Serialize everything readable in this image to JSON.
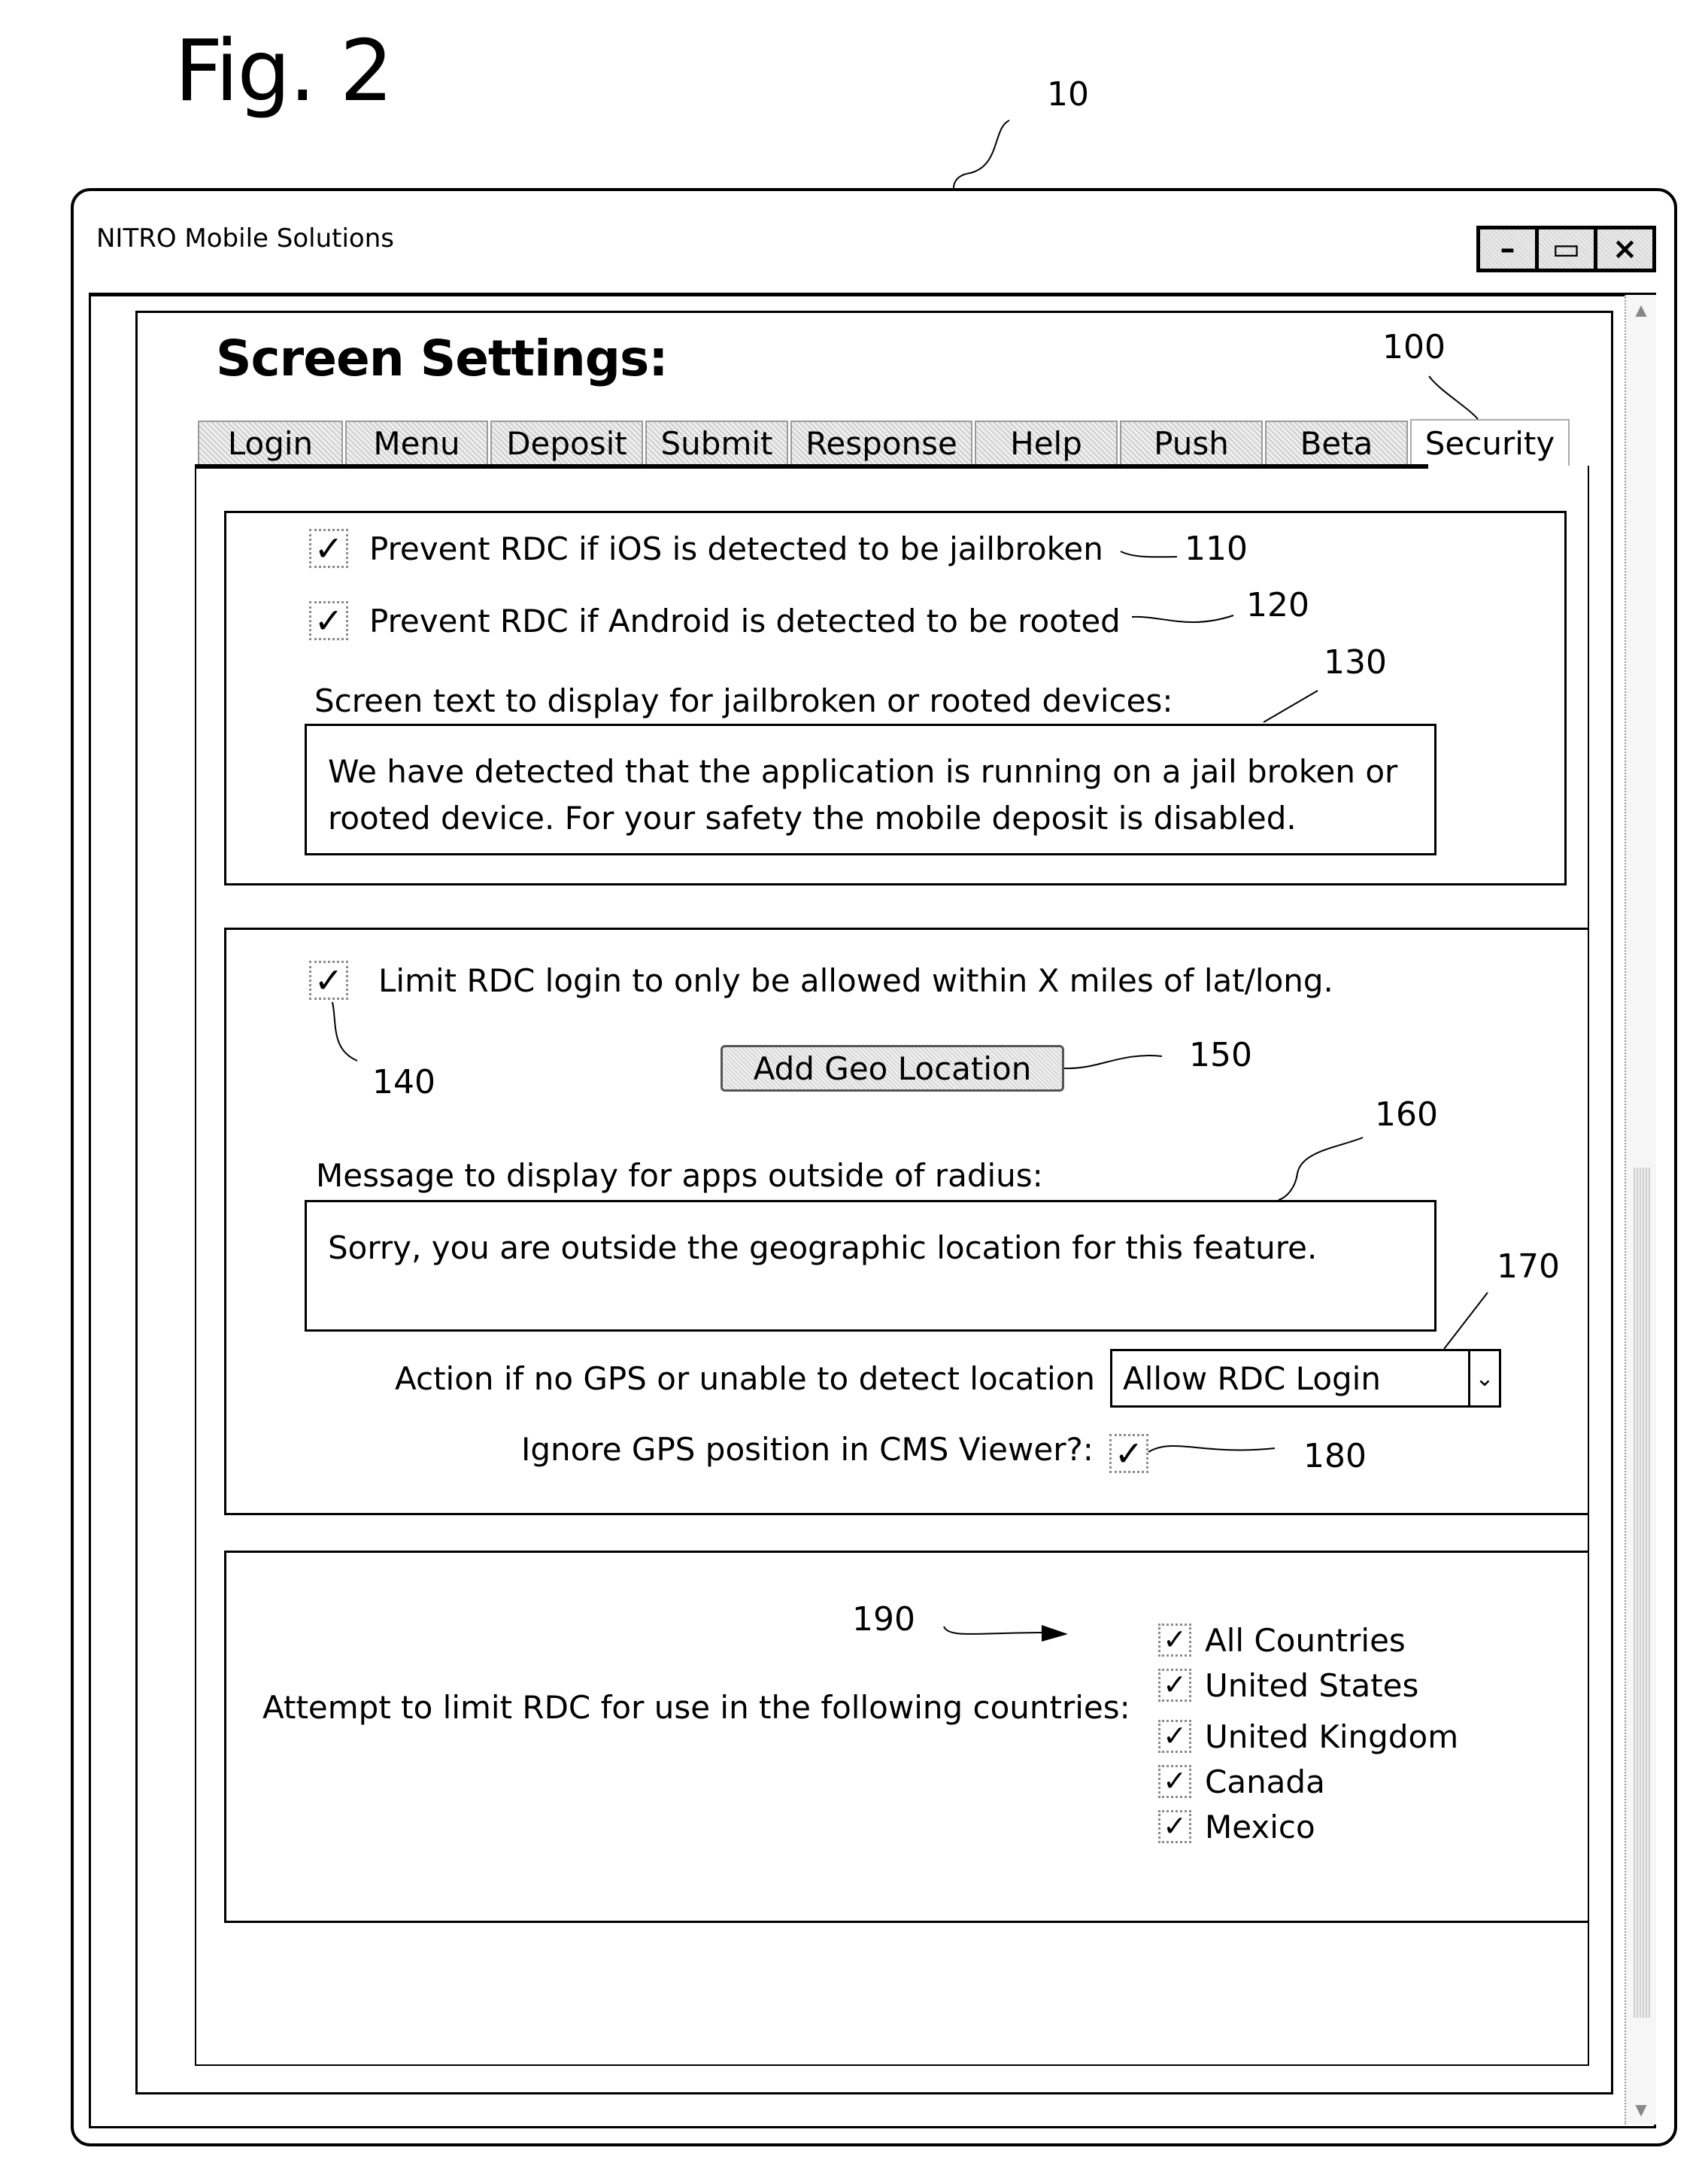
{
  "figure": {
    "label": "Fig. 2",
    "refs": {
      "window": "10",
      "security_tab": "100",
      "ios_checkbox": "110",
      "android_checkbox": "120",
      "screen_text": "130",
      "geo_checkbox": "140",
      "add_geo_button": "150",
      "radius_message": "160",
      "gps_action": "170",
      "ignore_gps": "180",
      "countries": "190"
    }
  },
  "window": {
    "title": "NITRO Mobile Solutions",
    "controls": {
      "minimize": "–",
      "maximize": "▭",
      "close": "×"
    }
  },
  "page": {
    "title": "Screen Settings:"
  },
  "tabs": [
    {
      "label": "Login",
      "active": false
    },
    {
      "label": "Menu",
      "active": false
    },
    {
      "label": "Deposit",
      "active": false
    },
    {
      "label": "Submit",
      "active": false
    },
    {
      "label": "Response",
      "active": false
    },
    {
      "label": "Help",
      "active": false
    },
    {
      "label": "Push",
      "active": false
    },
    {
      "label": "Beta",
      "active": false
    },
    {
      "label": "Security",
      "active": true
    }
  ],
  "jailbreak": {
    "ios_check": {
      "label": "Prevent RDC if iOS is detected to be jailbroken",
      "checked": true
    },
    "android_check": {
      "label": "Prevent RDC if Android is detected to be rooted",
      "checked": true
    },
    "screen_text_label": "Screen text to display for jailbroken or rooted devices:",
    "screen_text_value": "We have detected that the application is running on a jail broken or rooted device.  For your safety the mobile deposit is disabled."
  },
  "geo": {
    "limit_check": {
      "label": "Limit RDC login to only be allowed within X miles of lat/long.",
      "checked": true
    },
    "add_button": "Add Geo Location",
    "message_label": "Message to display for apps outside of radius:",
    "message_value": "Sorry, you are outside the geographic location for this feature.",
    "no_gps_label": "Action if no GPS or unable to detect location",
    "no_gps_selected": "Allow RDC Login",
    "ignore_label": "Ignore GPS position in CMS Viewer?:",
    "ignore_checked": true
  },
  "countries": {
    "label": "Attempt to limit RDC for use in the following countries:",
    "items": [
      {
        "label": "All Countries",
        "checked": true
      },
      {
        "label": "United States",
        "checked": true
      },
      {
        "label": "United Kingdom",
        "checked": true
      },
      {
        "label": "Canada",
        "checked": true
      },
      {
        "label": "Mexico",
        "checked": true
      }
    ]
  },
  "icons": {
    "check": "✓",
    "dropdown": "⌄",
    "scroll_up": "▲",
    "scroll_down": "▼"
  }
}
